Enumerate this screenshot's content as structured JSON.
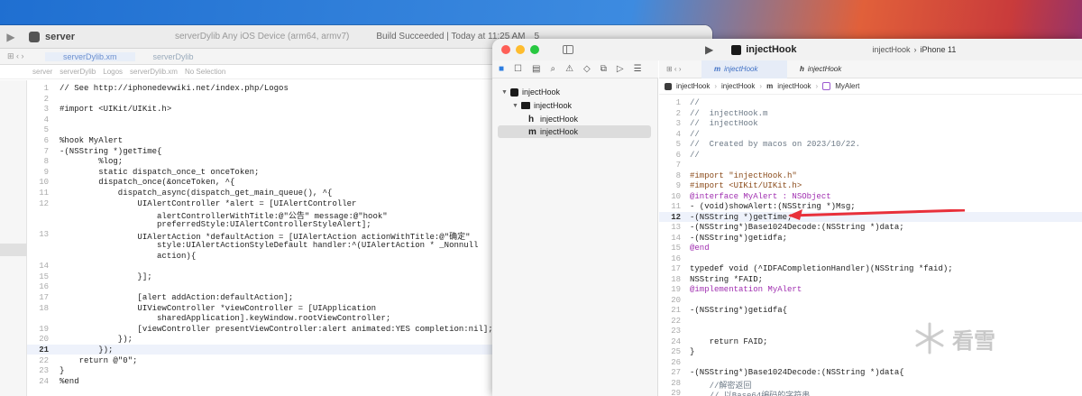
{
  "window1": {
    "toolbar": {
      "scheme": "server",
      "destination": "serverDylib  Any iOS Device (arm64, armv7)",
      "status": "Build Succeeded | Today at 11:25 AM",
      "badge": "5"
    },
    "tabs": [
      "serverDylib.xm",
      "serverDylib"
    ],
    "jump": [
      "server",
      "serverDylib",
      "Logos",
      "serverDylib.xm",
      "No Selection"
    ],
    "lines": [
      {
        "n": "1",
        "t": "// See http://iphonedevwiki.net/index.php/Logos"
      },
      {
        "n": "2",
        "t": ""
      },
      {
        "n": "3",
        "t": "#import <UIKit/UIKit.h>"
      },
      {
        "n": "4",
        "t": ""
      },
      {
        "n": "5",
        "t": ""
      },
      {
        "n": "6",
        "t": "%hook MyAlert"
      },
      {
        "n": "7",
        "t": "-(NSString *)getTime{"
      },
      {
        "n": "8",
        "t": "        %log;"
      },
      {
        "n": "9",
        "t": "        static dispatch_once_t onceToken;"
      },
      {
        "n": "10",
        "t": "        dispatch_once(&onceToken, ^{"
      },
      {
        "n": "11",
        "t": "            dispatch_async(dispatch_get_main_queue(), ^{"
      },
      {
        "n": "12",
        "t": "                UIAlertController *alert = [UIAlertController"
      },
      {
        "n": "",
        "t": "                    alertControllerWithTitle:@\"公告\" message:@\"hook\""
      },
      {
        "n": "",
        "t": "                    preferredStyle:UIAlertControllerStyleAlert];"
      },
      {
        "n": "13",
        "t": "                UIAlertAction *defaultAction = [UIAlertAction actionWithTitle:@\"确定\""
      },
      {
        "n": "",
        "t": "                    style:UIAlertActionStyleDefault handler:^(UIAlertAction * _Nonnull"
      },
      {
        "n": "",
        "t": "                    action){"
      },
      {
        "n": "14",
        "t": ""
      },
      {
        "n": "15",
        "t": "                }];"
      },
      {
        "n": "16",
        "t": ""
      },
      {
        "n": "17",
        "t": "                [alert addAction:defaultAction];"
      },
      {
        "n": "18",
        "t": "                UIViewController *viewController = [UIApplication"
      },
      {
        "n": "",
        "t": "                    sharedApplication].keyWindow.rootViewController;"
      },
      {
        "n": "19",
        "t": "                [viewController presentViewController:alert animated:YES completion:nil];"
      },
      {
        "n": "20",
        "t": "            });"
      },
      {
        "n": "21",
        "t": "        });"
      },
      {
        "n": "22",
        "t": "    return @\"0\";"
      },
      {
        "n": "23",
        "t": "}"
      },
      {
        "n": "24",
        "t": "%end"
      }
    ]
  },
  "window2": {
    "toolbar": {
      "title": "injectHook",
      "scheme": "injectHook",
      "device": "iPhone 11"
    },
    "navigator": {
      "project": "injectHook",
      "group": "injectHook",
      "files": [
        "injectHook",
        "injectHook"
      ]
    },
    "tabs": [
      "injectHook",
      "injectHook"
    ],
    "jump": [
      "injectHook",
      "injectHook",
      "injectHook",
      "MyAlert"
    ],
    "lines": [
      {
        "n": "1",
        "t": "//",
        "c": "c-com"
      },
      {
        "n": "2",
        "t": "//  injectHook.m",
        "c": "c-com"
      },
      {
        "n": "3",
        "t": "//  injectHook",
        "c": "c-com"
      },
      {
        "n": "4",
        "t": "//",
        "c": "c-com"
      },
      {
        "n": "5",
        "t": "//  Created by macos on 2023/10/22.",
        "c": "c-com"
      },
      {
        "n": "6",
        "t": "//",
        "c": "c-com"
      },
      {
        "n": "7",
        "t": "",
        "c": "c-pl"
      },
      {
        "n": "8",
        "t": "#import \"injectHook.h\"",
        "c": "c-pp"
      },
      {
        "n": "9",
        "t": "#import <UIKit/UIKit.h>",
        "c": "c-pp"
      },
      {
        "n": "10",
        "t": "@interface MyAlert : NSObject",
        "c": "c-kw"
      },
      {
        "n": "11",
        "t": "- (void)showAlert:(NSString *)Msg;",
        "c": "c-pl"
      },
      {
        "n": "12",
        "t": "-(NSString *)getTime;",
        "c": "c-pl"
      },
      {
        "n": "13",
        "t": "-(NSString*)Base1024Decode:(NSString *)data;",
        "c": "c-pl"
      },
      {
        "n": "14",
        "t": "-(NSString*)getidfa;",
        "c": "c-pl"
      },
      {
        "n": "15",
        "t": "@end",
        "c": "c-kw"
      },
      {
        "n": "16",
        "t": "",
        "c": "c-pl"
      },
      {
        "n": "17",
        "t": "typedef void (^IDFACompletionHandler)(NSString *faid);",
        "c": "c-pl"
      },
      {
        "n": "18",
        "t": "NSString *FAID;",
        "c": "c-pl"
      },
      {
        "n": "19",
        "t": "@implementation MyAlert",
        "c": "c-kw"
      },
      {
        "n": "20",
        "t": "",
        "c": "c-pl"
      },
      {
        "n": "21",
        "t": "-(NSString*)getidfa{",
        "c": "c-pl"
      },
      {
        "n": "22",
        "t": "",
        "c": "c-pl"
      },
      {
        "n": "23",
        "t": "",
        "c": "c-pl"
      },
      {
        "n": "24",
        "t": "    return FAID;",
        "c": "c-pl"
      },
      {
        "n": "25",
        "t": "}",
        "c": "c-pl"
      },
      {
        "n": "26",
        "t": "",
        "c": "c-pl"
      },
      {
        "n": "27",
        "t": "-(NSString*)Base1024Decode:(NSString *)data{",
        "c": "c-pl"
      },
      {
        "n": "28",
        "t": "    //解密返回",
        "c": "c-com"
      },
      {
        "n": "29",
        "t": "    // 以Base64编码的字符串",
        "c": "c-com"
      }
    ]
  },
  "watermark": "看雪",
  "colors": {
    "arrow": "#e8303a",
    "line_highlight": "#eef2fb",
    "accent": "#3e6fc4"
  }
}
